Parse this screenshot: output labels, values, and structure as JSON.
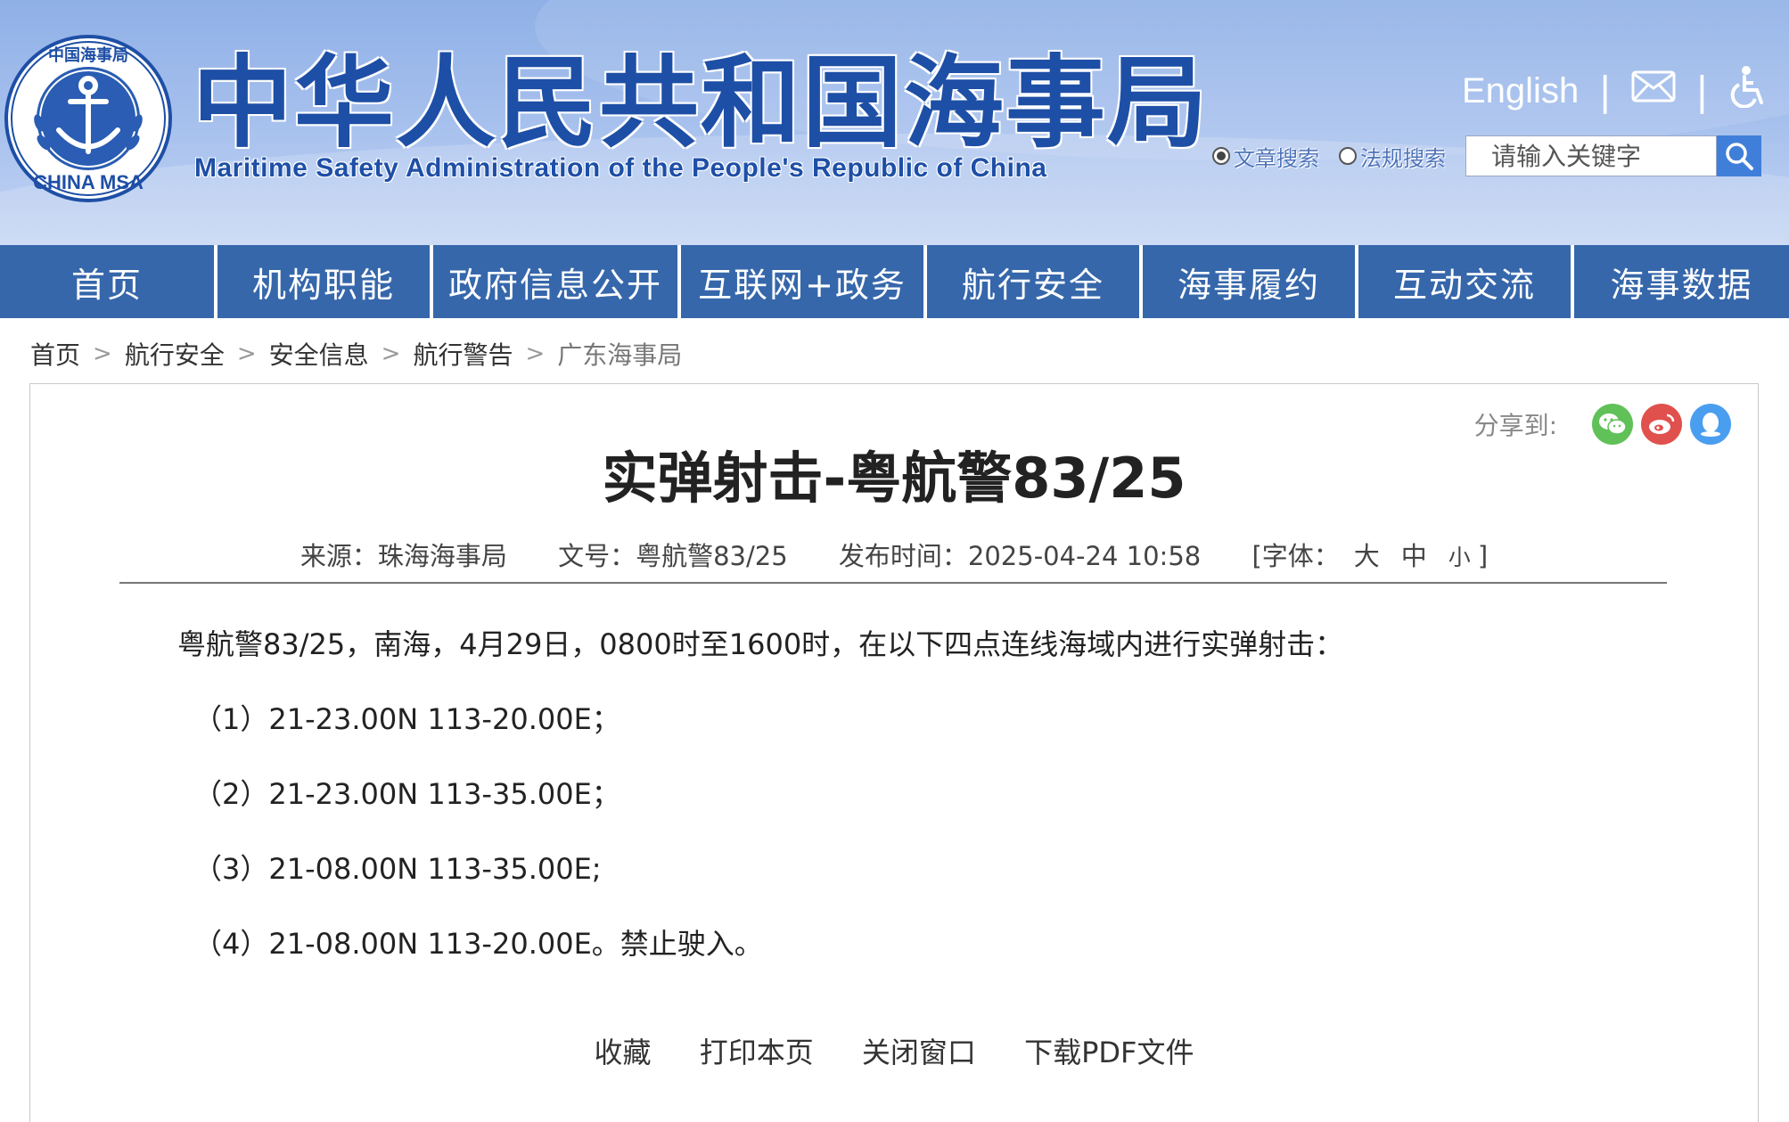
{
  "header": {
    "title": "中华人民共和国海事局",
    "subtitle": "Maritime Safety Administration of the People's Republic of China",
    "logo_text_top": "中国海事局",
    "logo_text_bottom": "CHINA MSA",
    "english_link": "English",
    "separator": "|"
  },
  "search": {
    "option_article": "文章搜索",
    "option_law": "法规搜索",
    "selected": "文章搜索",
    "placeholder": "请输入关键字"
  },
  "nav": {
    "items": [
      {
        "label": "首页"
      },
      {
        "label": "机构职能"
      },
      {
        "label": "政府信息公开"
      },
      {
        "label": "互联网+政务"
      },
      {
        "label": "航行安全"
      },
      {
        "label": "海事履约"
      },
      {
        "label": "互动交流"
      },
      {
        "label": "海事数据"
      }
    ]
  },
  "breadcrumb": {
    "items": [
      "首页",
      "航行安全",
      "安全信息",
      "航行警告",
      "广东海事局"
    ],
    "separator": ">"
  },
  "share": {
    "label": "分享到:",
    "icons": [
      "wechat-icon",
      "weibo-icon",
      "qq-icon"
    ]
  },
  "article": {
    "title": "实弹射击-粤航警83/25",
    "source": "来源：珠海海事局",
    "doc_no": "文号：粤航警83/25",
    "publish_time": "发布时间：2025-04-24 10:58",
    "font_label": "[字体：",
    "font_large": "大",
    "font_medium": "中",
    "font_small": "小",
    "font_end": "]",
    "intro": "粤航警83/25，南海，4月29日，0800时至1600时，在以下四点连线海域内进行实弹射击：",
    "points": [
      "（1）21-23.00N 113-20.00E；",
      "（2）21-23.00N 113-35.00E；",
      "（3）21-08.00N 113-35.00E;",
      "（4）21-08.00N 113-20.00E。禁止驶入。"
    ]
  },
  "actions": {
    "favorite": "收藏",
    "print": "打印本页",
    "close": "关闭窗口",
    "download_pdf": "下载PDF文件"
  },
  "colors": {
    "nav_bg": "#3667ab",
    "header_title": "#1e4fa6",
    "wechat": "#5fc158",
    "weibo": "#e0504d",
    "qq": "#4a9ef0"
  }
}
